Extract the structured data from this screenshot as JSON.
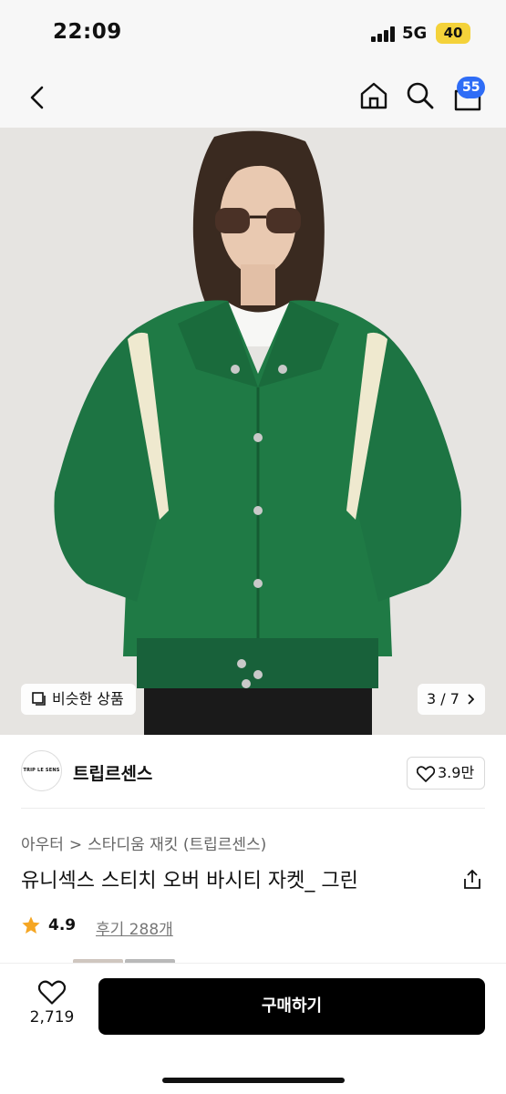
{
  "status_bar": {
    "time": "22:09",
    "network": "5G",
    "battery": "40"
  },
  "nav": {
    "back_icon": "chevron-left-icon",
    "home_icon": "home-icon",
    "search_icon": "search-icon",
    "cart_icon": "shopping-bag-icon",
    "cart_badge": "55"
  },
  "gallery": {
    "similar_label": "비슷한 상품",
    "page_indicator": "3 / 7",
    "current_page": 3,
    "total_pages": 7,
    "jacket_color": "#1f7a45"
  },
  "brand": {
    "logo_text": "TRIP LE SENS",
    "name": "트립르센스",
    "like_count": "3.9만"
  },
  "product": {
    "breadcrumb": [
      "아우터",
      "스타디움 재킷 (트립르센스)"
    ],
    "title": "유니섹스 스티치 오버 바시티 자켓_ 그린",
    "rating": "4.9",
    "reviews": "후기 288개"
  },
  "bottom": {
    "wish_count": "2,719",
    "buy_label": "구매하기"
  },
  "colors": {
    "accent": "#2f6df6",
    "star": "#f5a623",
    "primary_button": "#000000"
  }
}
